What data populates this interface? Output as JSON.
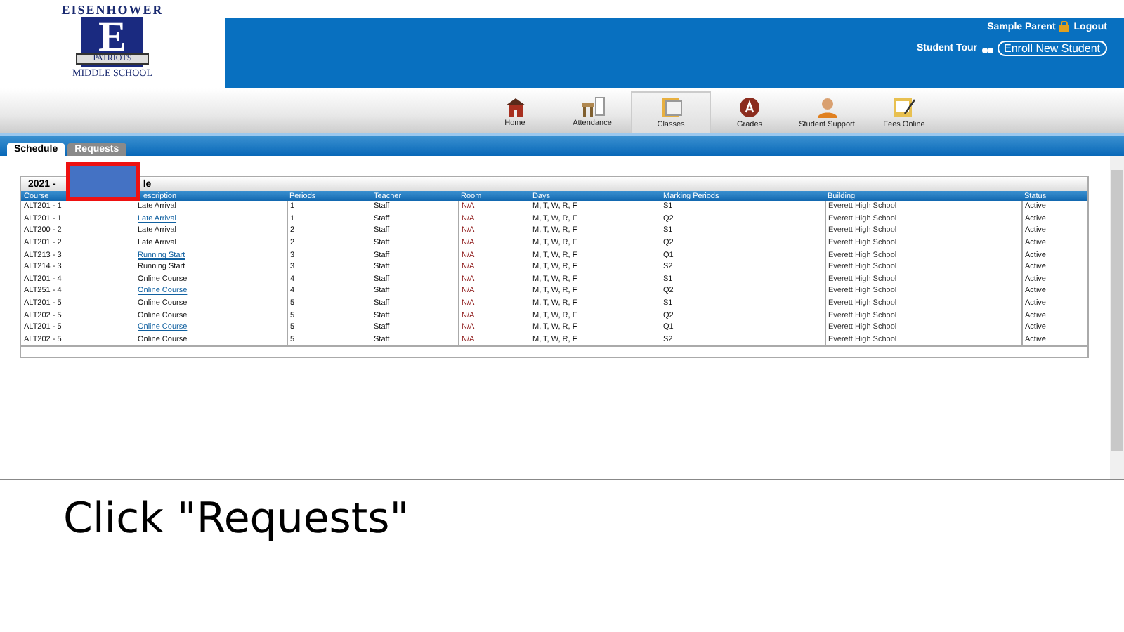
{
  "school_logo": {
    "arc_text": "EISENHOWER",
    "letter": "E",
    "banner": "PATRIOTS",
    "bottom_text": "MIDDLE SCHOOL"
  },
  "user_bar": {
    "user": "Sample Parent",
    "logout": "Logout",
    "tour": "Student Tour",
    "enroll_button": "Enroll New Student"
  },
  "nav": [
    {
      "label": "Home",
      "selected": false
    },
    {
      "label": "Attendance",
      "selected": false
    },
    {
      "label": "Classes",
      "selected": true
    },
    {
      "label": "Grades",
      "selected": false
    },
    {
      "label": "Student Support",
      "selected": false
    },
    {
      "label": "Fees Online",
      "selected": false
    }
  ],
  "tabs": [
    {
      "label": "Schedule",
      "selected": true
    },
    {
      "label": "Requests",
      "selected": false
    }
  ],
  "schedule": {
    "title_start": "2021 -",
    "title_end": "le",
    "columns": [
      "Course",
      "escription",
      "Periods",
      "Teacher",
      "Room",
      "Days",
      "Marking Periods",
      "Building",
      "Status"
    ],
    "rows": [
      {
        "cells": [
          "ALT201 - 1",
          "Late Arrival",
          "1",
          "Staff",
          "N/A",
          "M, T, W, R, F",
          "S1",
          "Everett High School",
          "Active"
        ],
        "link": false
      },
      {
        "cells": [
          "ALT201 - 1",
          "Late Arrival",
          "1",
          "Staff",
          "N/A",
          "M, T, W, R, F",
          "Q2",
          "Everett High School",
          "Active"
        ],
        "link": true
      },
      {
        "cells": [
          "ALT200 - 2",
          "Late Arrival",
          "2",
          "Staff",
          "N/A",
          "M, T, W, R, F",
          "S1",
          "Everett High School",
          "Active"
        ],
        "link": false
      },
      {
        "cells": [
          "ALT201 - 2",
          "Late Arrival",
          "2",
          "Staff",
          "N/A",
          "M, T, W, R, F",
          "Q2",
          "Everett High School",
          "Active"
        ],
        "link": false
      },
      {
        "cells": [
          "ALT213 - 3",
          "Running Start",
          "3",
          "Staff",
          "N/A",
          "M, T, W, R, F",
          "Q1",
          "Everett High School",
          "Active"
        ],
        "link": true
      },
      {
        "cells": [
          "ALT214 - 3",
          "Running Start",
          "3",
          "Staff",
          "N/A",
          "M, T, W, R, F",
          "S2",
          "Everett High School",
          "Active"
        ],
        "link": false
      },
      {
        "cells": [
          "ALT201 - 4",
          "Online Course",
          "4",
          "Staff",
          "N/A",
          "M, T, W, R, F",
          "S1",
          "Everett High School",
          "Active"
        ],
        "link": false
      },
      {
        "cells": [
          "ALT251 - 4",
          "Online Course",
          "4",
          "Staff",
          "N/A",
          "M, T, W, R, F",
          "Q2",
          "Everett High School",
          "Active"
        ],
        "link": true
      },
      {
        "cells": [
          "ALT201 - 5",
          "Online Course",
          "5",
          "Staff",
          "N/A",
          "M, T, W, R, F",
          "S1",
          "Everett High School",
          "Active"
        ],
        "link": false
      },
      {
        "cells": [
          "ALT202 - 5",
          "Online Course",
          "5",
          "Staff",
          "N/A",
          "M, T, W, R, F",
          "Q2",
          "Everett High School",
          "Active"
        ],
        "link": false
      },
      {
        "cells": [
          "ALT201 - 5",
          "Online Course",
          "5",
          "Staff",
          "N/A",
          "M, T, W, R, F",
          "Q1",
          "Everett High School",
          "Active"
        ],
        "link": true
      },
      {
        "cells": [
          "ALT202 - 5",
          "Online Course",
          "5",
          "Staff",
          "N/A",
          "M, T, W, R, F",
          "S2",
          "Everett High School",
          "Active"
        ],
        "link": false
      }
    ]
  },
  "caption": "Click \"Requests\""
}
